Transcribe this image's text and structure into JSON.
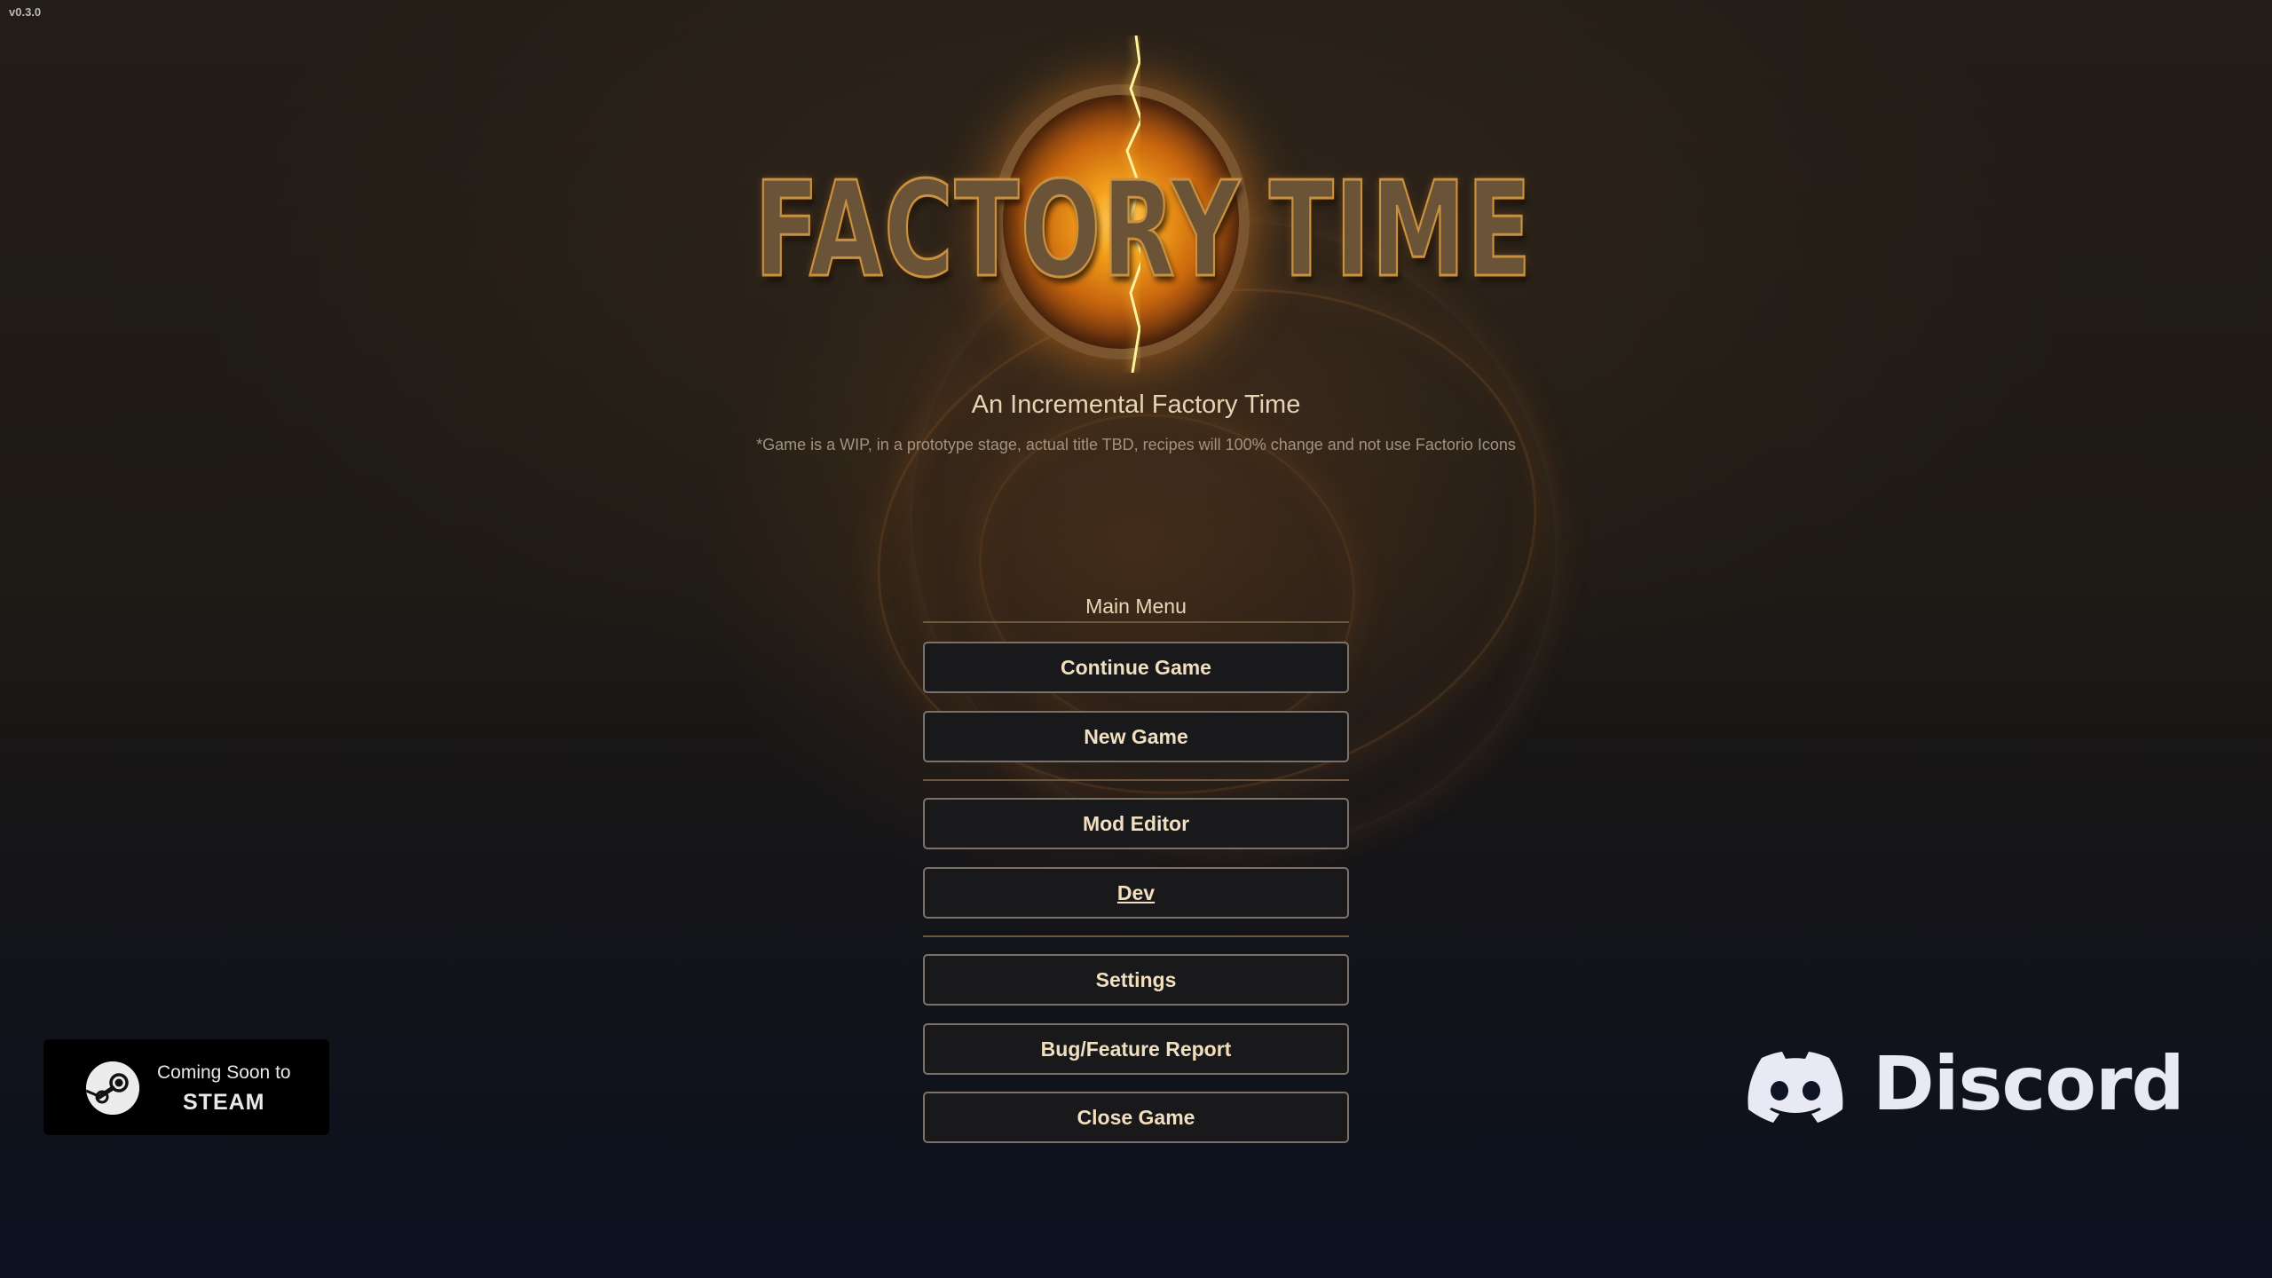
{
  "version": "v0.3.0",
  "logo": {
    "word_left": "FACTORY",
    "word_right": "TIME"
  },
  "subtitle": "An Incremental Factory Time",
  "disclaimer": "*Game is a WIP, in a prototype stage, actual title TBD, recipes will 100% change and not use Factorio Icons",
  "menu": {
    "title": "Main Menu",
    "buttons": [
      {
        "label": "Continue Game"
      },
      {
        "label": "New Game"
      },
      {
        "label": "Mod Editor"
      },
      {
        "label": "Dev"
      },
      {
        "label": "Settings"
      },
      {
        "label": "Bug/Feature Report"
      },
      {
        "label": "Close Game"
      }
    ]
  },
  "steam_badge": {
    "line1": "Coming Soon to",
    "line2": "STEAM",
    "icon": "steam-icon"
  },
  "discord_link": {
    "label": "Discord",
    "icon": "discord-icon"
  },
  "colors": {
    "button_bg": "#19191b",
    "button_border": "#7b7168",
    "button_text": "#f1dfbf",
    "accent_orange": "#f6a21c"
  }
}
